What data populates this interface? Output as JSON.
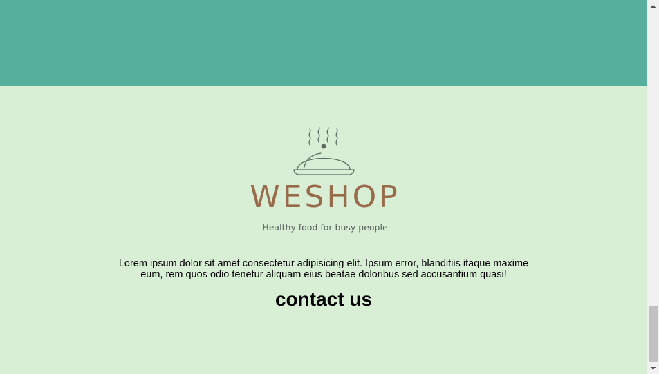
{
  "header": {
    "background_color": "#55af9c"
  },
  "footer": {
    "background_color": "#d8efd6",
    "logo": {
      "icon": "food-cloche-icon",
      "brand_name": "WESHOP",
      "tagline": "Healthy food for busy people",
      "brand_color": "#986b4a"
    },
    "description": "Lorem ipsum dolor sit amet consectetur adipisicing elit. Ipsum error, blanditiis itaque maxime eum, rem quos odio tenetur aliquam eius beatae doloribus sed accusantium quasi!",
    "contact_heading": "contact us"
  },
  "scrollbar": {
    "up_icon": "scroll-up-arrow-icon",
    "down_icon": "scroll-down-arrow-icon"
  }
}
